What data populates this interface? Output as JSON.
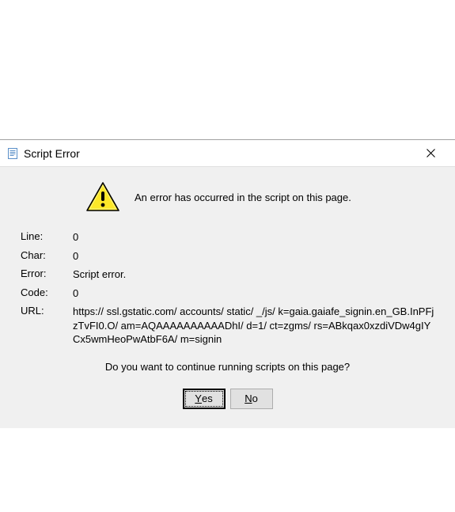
{
  "dialog": {
    "title": "Script Error",
    "message": "An error has occurred in the script on this page.",
    "details": {
      "line_label": "Line:",
      "line_value": "0",
      "char_label": "Char:",
      "char_value": "0",
      "error_label": "Error:",
      "error_value": "Script error.",
      "code_label": "Code:",
      "code_value": "0",
      "url_label": "URL:",
      "url_value": "https:// ssl.gstatic.com/ accounts/ static/ _/js/ k=gaia.gaiafe_signin.en_GB.InPFjzTvFI0.O/ am=AQAAAAAAAAAADhI/ d=1/ ct=zgms/ rs=ABkqax0xzdiVDw4gIYCx5wmHeoPwAtbF6A/ m=signin"
    },
    "prompt": "Do you want to continue running scripts on this page?",
    "buttons": {
      "yes_prefix": "Y",
      "yes_rest": "es",
      "no_prefix": "N",
      "no_rest": "o"
    }
  }
}
